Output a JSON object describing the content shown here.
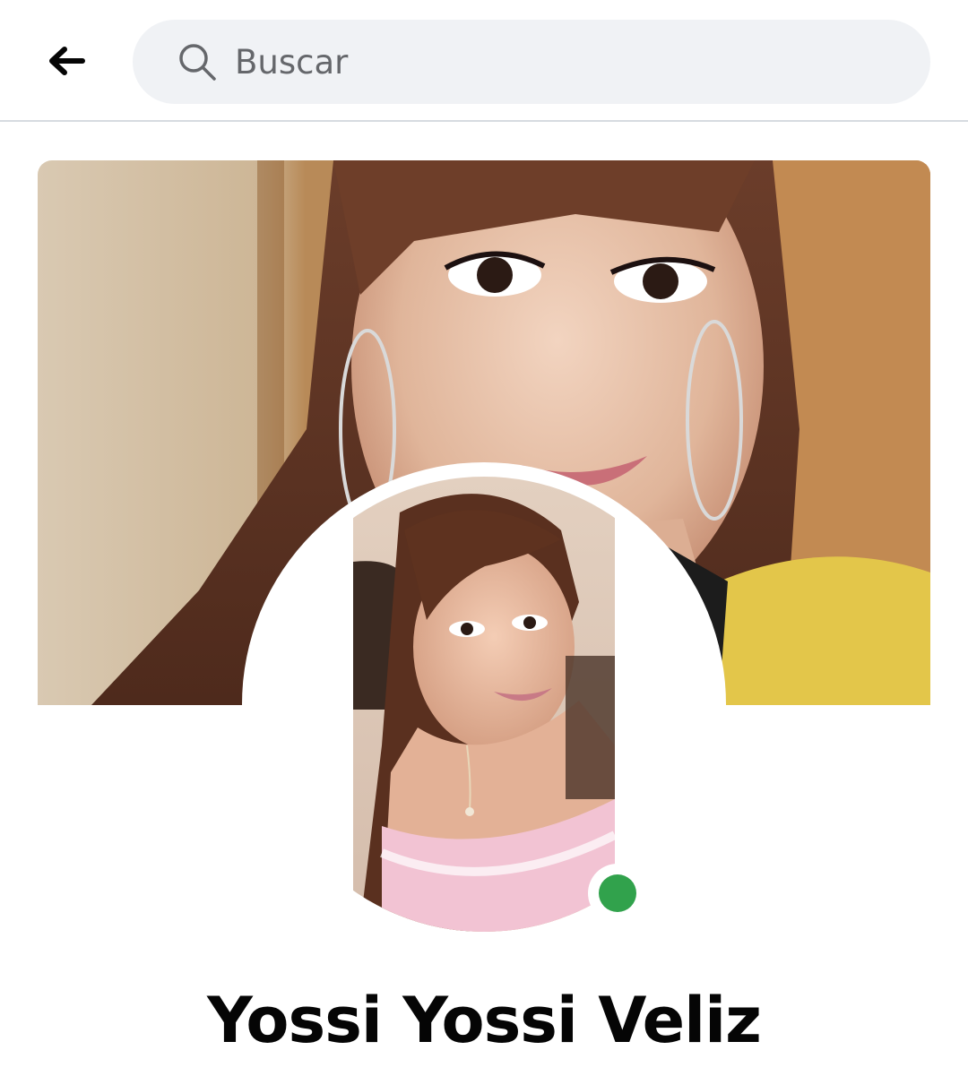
{
  "header": {
    "back_icon": "arrow-left-icon",
    "search": {
      "placeholder": "Buscar",
      "icon": "search-icon"
    }
  },
  "profile": {
    "name": "Yossi Yossi Veliz",
    "online_status": "online",
    "online_color": "#31a24c"
  },
  "colors": {
    "search_bg": "#f0f2f5",
    "text_primary": "#050505",
    "text_secondary": "#65676b",
    "divider": "#d6dbe0"
  }
}
